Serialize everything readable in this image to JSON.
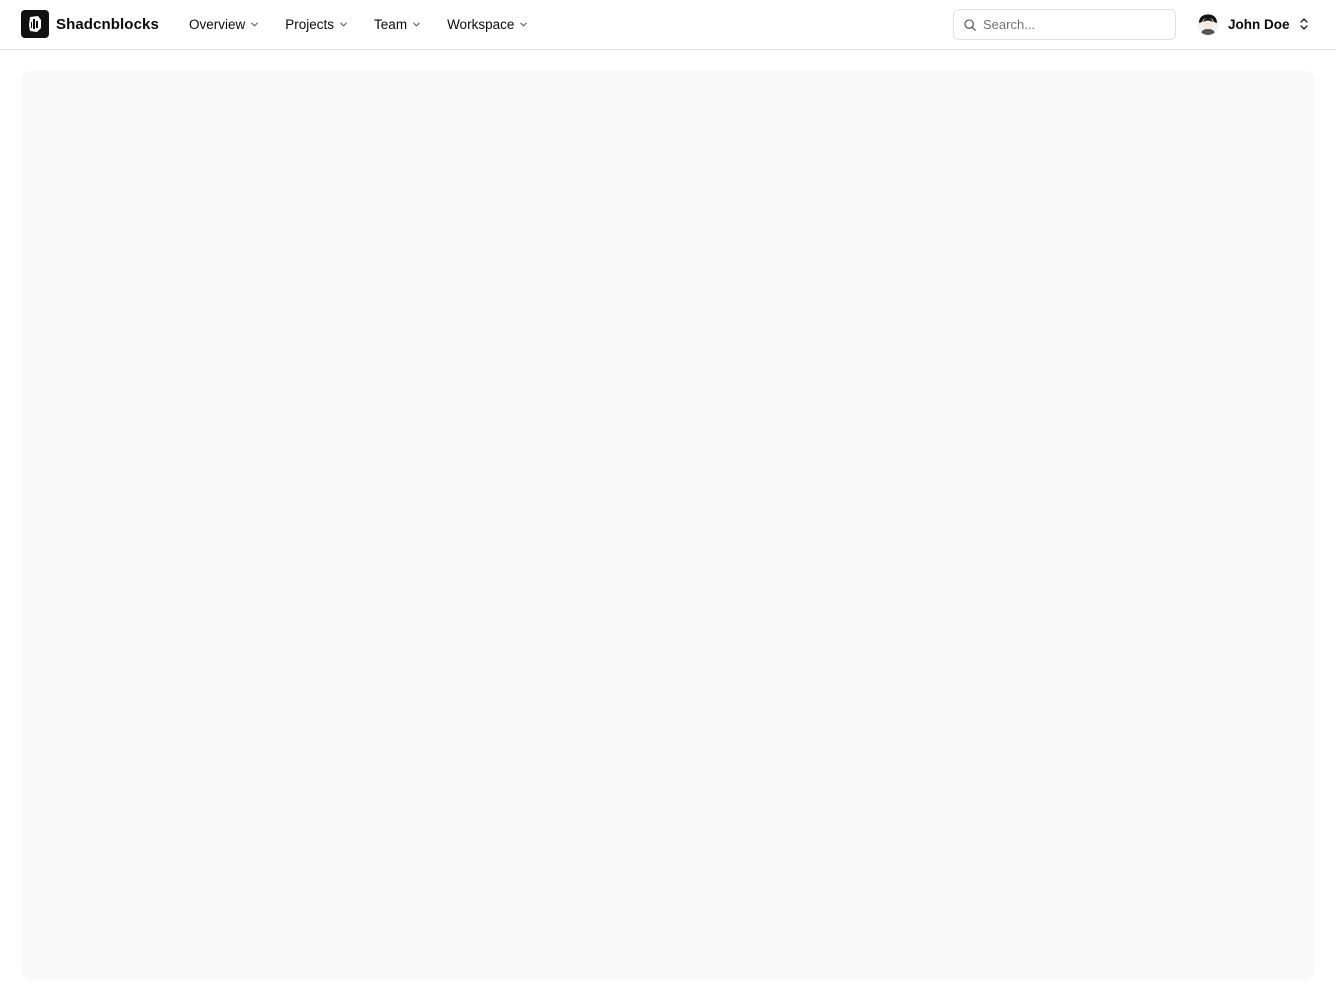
{
  "brand": {
    "name": "Shadcnblocks",
    "logo_icon": "shadcnblocks-logo-icon",
    "logo_color": "#111111"
  },
  "nav": {
    "items": [
      {
        "label": "Overview"
      },
      {
        "label": "Projects"
      },
      {
        "label": "Team"
      },
      {
        "label": "Workspace"
      }
    ]
  },
  "search": {
    "placeholder": "Search...",
    "value": ""
  },
  "user": {
    "name": "John Doe"
  },
  "colors": {
    "content_panel": "#f9f9f9",
    "border": "#e5e5e5",
    "text": "#0a0a0a",
    "muted": "#737373"
  }
}
